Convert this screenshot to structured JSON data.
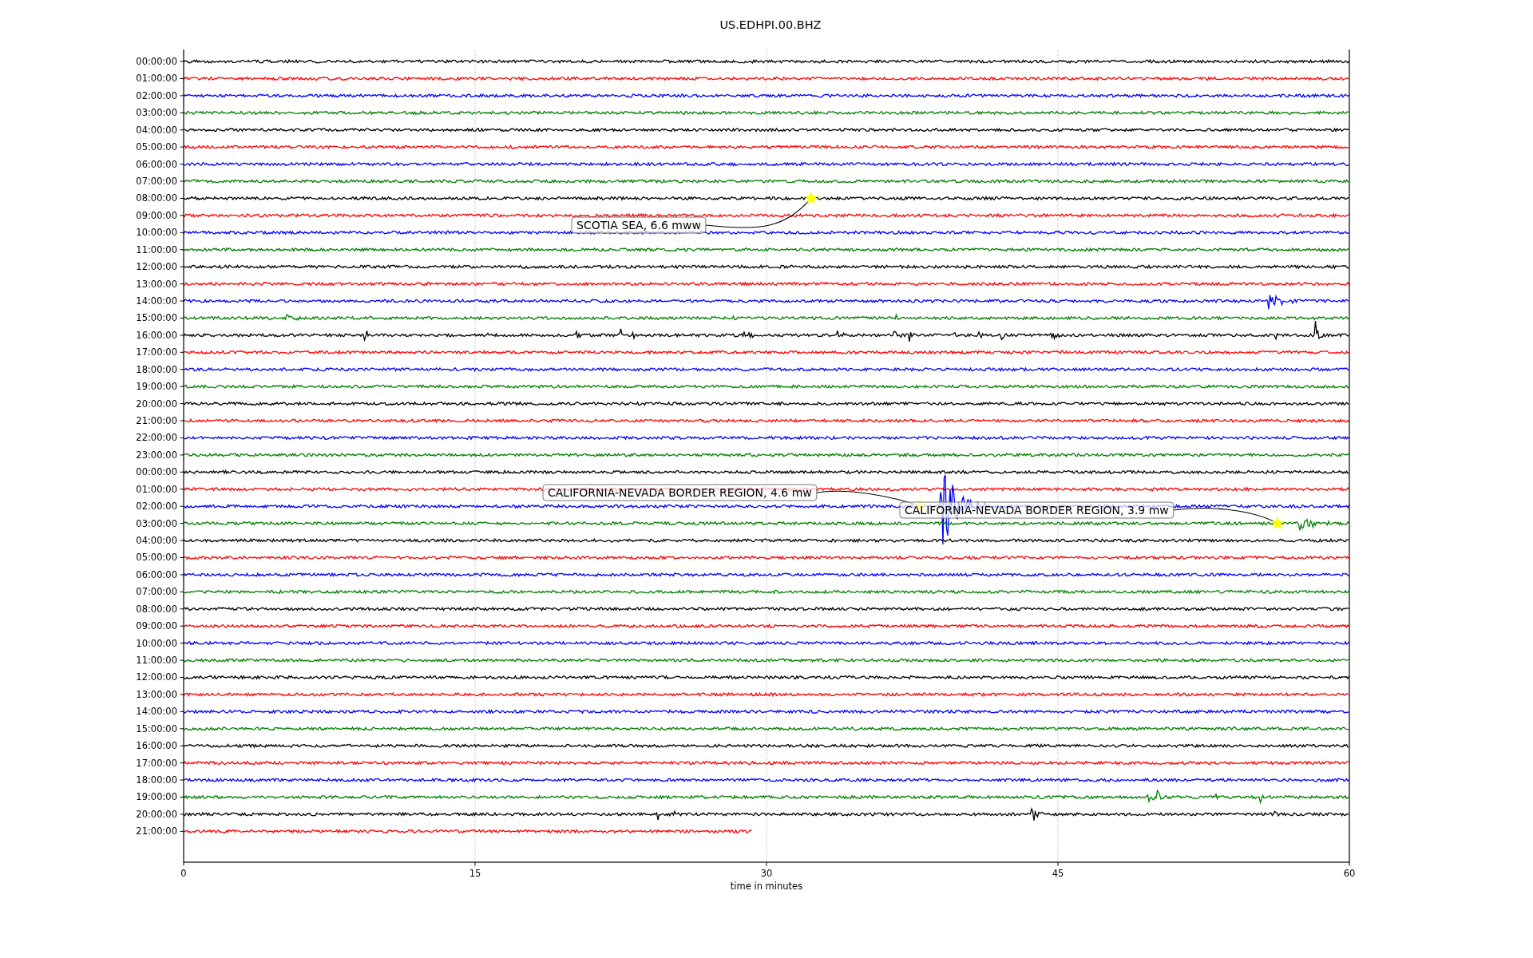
{
  "title": "US.EDHPI.00.BHZ",
  "xlabel": "time in minutes",
  "xticks": [
    "0",
    "15",
    "30",
    "45",
    "60"
  ],
  "rows": [
    {
      "label": "00:00:00",
      "color": "#000000",
      "kind": "full"
    },
    {
      "label": "01:00:00",
      "color": "#ff0000",
      "kind": "full"
    },
    {
      "label": "02:00:00",
      "color": "#0000ff",
      "kind": "full"
    },
    {
      "label": "03:00:00",
      "color": "#008000",
      "kind": "full"
    },
    {
      "label": "04:00:00",
      "color": "#000000",
      "kind": "full"
    },
    {
      "label": "05:00:00",
      "color": "#ff0000",
      "kind": "full"
    },
    {
      "label": "06:00:00",
      "color": "#0000ff",
      "kind": "full"
    },
    {
      "label": "07:00:00",
      "color": "#008000",
      "kind": "full"
    },
    {
      "label": "08:00:00",
      "color": "#000000",
      "kind": "full"
    },
    {
      "label": "09:00:00",
      "color": "#ff0000",
      "kind": "full"
    },
    {
      "label": "10:00:00",
      "color": "#0000ff",
      "kind": "full"
    },
    {
      "label": "11:00:00",
      "color": "#008000",
      "kind": "full"
    },
    {
      "label": "12:00:00",
      "color": "#000000",
      "kind": "full"
    },
    {
      "label": "13:00:00",
      "color": "#ff0000",
      "kind": "full"
    },
    {
      "label": "14:00:00",
      "color": "#0000ff",
      "kind": "full"
    },
    {
      "label": "15:00:00",
      "color": "#008000",
      "kind": "full"
    },
    {
      "label": "16:00:00",
      "color": "#000000",
      "kind": "full"
    },
    {
      "label": "17:00:00",
      "color": "#ff0000",
      "kind": "full"
    },
    {
      "label": "18:00:00",
      "color": "#0000ff",
      "kind": "full"
    },
    {
      "label": "19:00:00",
      "color": "#008000",
      "kind": "full"
    },
    {
      "label": "20:00:00",
      "color": "#000000",
      "kind": "full"
    },
    {
      "label": "21:00:00",
      "color": "#ff0000",
      "kind": "full"
    },
    {
      "label": "22:00:00",
      "color": "#0000ff",
      "kind": "full"
    },
    {
      "label": "23:00:00",
      "color": "#008000",
      "kind": "full"
    },
    {
      "label": "00:00:00",
      "color": "#000000",
      "kind": "full"
    },
    {
      "label": "01:00:00",
      "color": "#ff0000",
      "kind": "full"
    },
    {
      "label": "02:00:00",
      "color": "#0000ff",
      "kind": "full"
    },
    {
      "label": "03:00:00",
      "color": "#008000",
      "kind": "full"
    },
    {
      "label": "04:00:00",
      "color": "#000000",
      "kind": "full"
    },
    {
      "label": "05:00:00",
      "color": "#ff0000",
      "kind": "full"
    },
    {
      "label": "06:00:00",
      "color": "#0000ff",
      "kind": "full"
    },
    {
      "label": "07:00:00",
      "color": "#008000",
      "kind": "full"
    },
    {
      "label": "08:00:00",
      "color": "#000000",
      "kind": "full"
    },
    {
      "label": "09:00:00",
      "color": "#ff0000",
      "kind": "full"
    },
    {
      "label": "10:00:00",
      "color": "#0000ff",
      "kind": "full"
    },
    {
      "label": "11:00:00",
      "color": "#008000",
      "kind": "full"
    },
    {
      "label": "12:00:00",
      "color": "#000000",
      "kind": "full"
    },
    {
      "label": "13:00:00",
      "color": "#ff0000",
      "kind": "full"
    },
    {
      "label": "14:00:00",
      "color": "#0000ff",
      "kind": "full"
    },
    {
      "label": "15:00:00",
      "color": "#008000",
      "kind": "full"
    },
    {
      "label": "16:00:00",
      "color": "#000000",
      "kind": "full"
    },
    {
      "label": "17:00:00",
      "color": "#ff0000",
      "kind": "full"
    },
    {
      "label": "18:00:00",
      "color": "#0000ff",
      "kind": "full"
    },
    {
      "label": "19:00:00",
      "color": "#008000",
      "kind": "full"
    },
    {
      "label": "20:00:00",
      "color": "#000000",
      "kind": "full"
    },
    {
      "label": "21:00:00",
      "color": "#ff0000",
      "kind": "partial"
    }
  ],
  "events": [
    {
      "label": "SCOTIA SEA, 6.6 mww"
    },
    {
      "label": "CALIFORNIA-NEVADA BORDER REGION, 4.6 mw"
    },
    {
      "label": "CALIFORNIA-NEVADA BORDER REGION, 3.9 mw"
    }
  ]
}
